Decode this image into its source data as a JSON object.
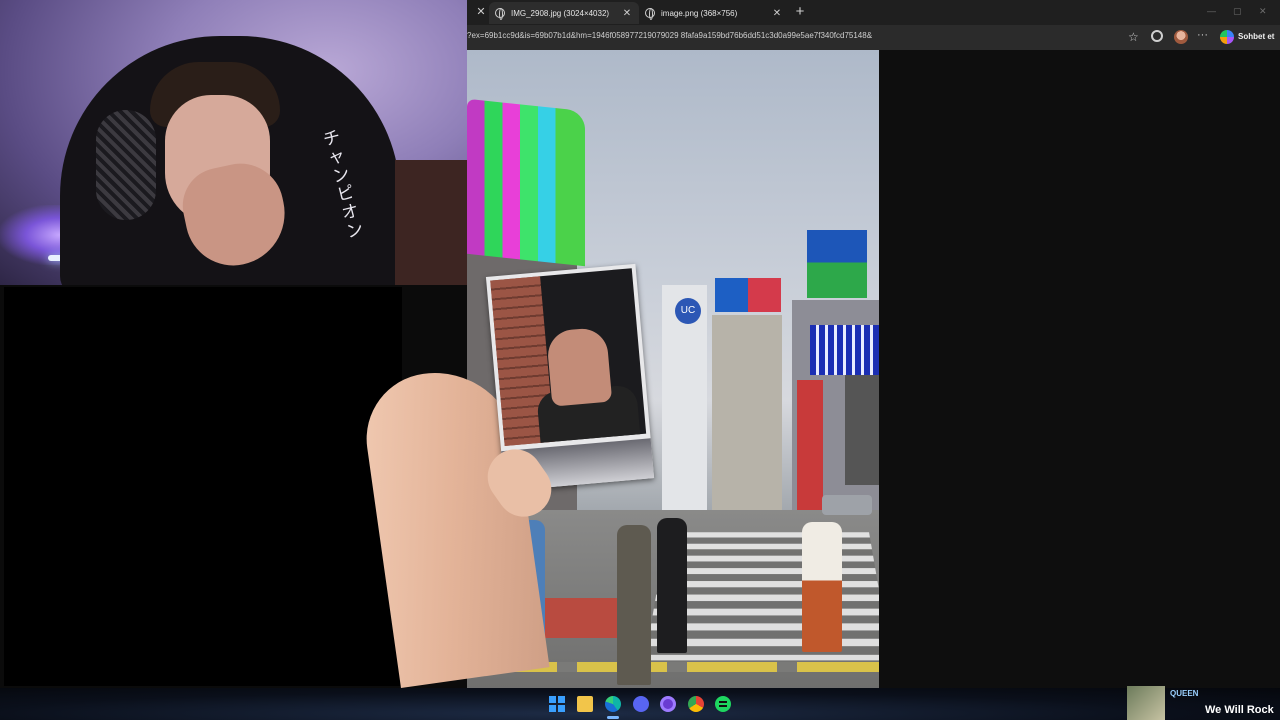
{
  "browser": {
    "tabs": [
      {
        "title": "IMG_2908.jpg (3024×4032)",
        "active": true
      },
      {
        "title": "image.png (368×756)",
        "active": false
      }
    ],
    "new_tab_symbol": "+",
    "address": "?ex=69b1cc9d&is=69b07b1d&hm=1946f058977219079029 8fafa9a159bd76b6dd51c3d0a99e5ae7f340fcd75148&",
    "copilot_label": "Sohbet et",
    "icons": [
      "globe-icon",
      "close-icon",
      "star-icon",
      "extension-icon",
      "profile-avatar",
      "more-icon",
      "copilot-icon"
    ]
  },
  "webcam": {
    "overlay_text": "チャンピオン"
  },
  "photo": {
    "uc_sign": "UC"
  },
  "taskbar": {
    "icons": [
      "windows-icon",
      "file-explorer-icon",
      "edge-icon",
      "discord-icon",
      "obs-icon",
      "chrome-icon",
      "spotify-icon"
    ],
    "now_playing": {
      "artist": "QUEEN",
      "song": "We Will Rock"
    }
  }
}
